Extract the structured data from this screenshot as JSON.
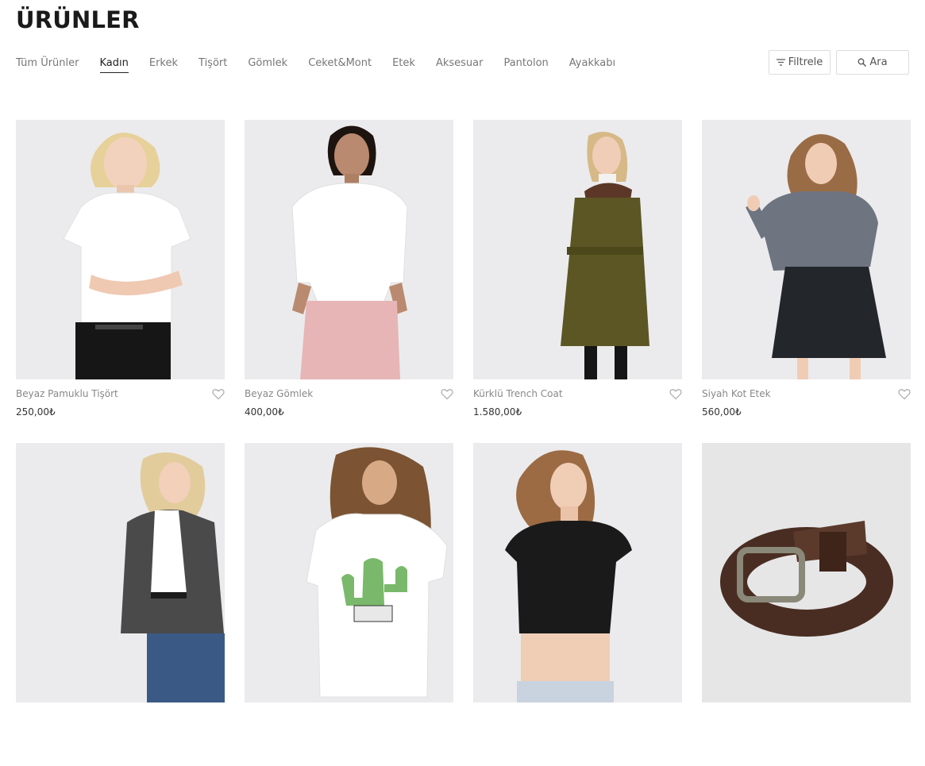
{
  "page_title": "ÜRÜNLER",
  "nav": {
    "items": [
      "Tüm Ürünler",
      "Kadın",
      "Erkek",
      "Tişört",
      "Gömlek",
      "Ceket&Mont",
      "Etek",
      "Aksesuar",
      "Pantolon",
      "Ayakkabı"
    ],
    "active": "Kadın"
  },
  "tools": {
    "filter_label": "Filtrele",
    "search_label": "Ara"
  },
  "products": [
    {
      "name": "Beyaz Pamuklu Tişört",
      "price": "250,00₺",
      "image": "blonde-woman-white-tshirt-black-jeans"
    },
    {
      "name": "Beyaz Gömlek",
      "price": "400,00₺",
      "image": "woman-white-shirt-pink-trousers"
    },
    {
      "name": "Kürklü Trench Coat",
      "price": "1.580,00₺",
      "image": "woman-olive-coat-fur-collar"
    },
    {
      "name": "Siyah Kot Etek",
      "price": "560,00₺",
      "image": "woman-grey-shirt-black-denim-skirt"
    },
    {
      "name": "",
      "price": "",
      "image": "woman-tweed-blazer-jeans"
    },
    {
      "name": "",
      "price": "",
      "image": "woman-cactus-print-tshirt"
    },
    {
      "name": "",
      "price": "",
      "image": "woman-black-crop-top"
    },
    {
      "name": "",
      "price": "",
      "image": "brown-leather-belt"
    }
  ],
  "colors": {
    "image_background": "#ebebed",
    "text_dark": "#222222",
    "text_muted": "#888888",
    "border": "#dddddd"
  }
}
